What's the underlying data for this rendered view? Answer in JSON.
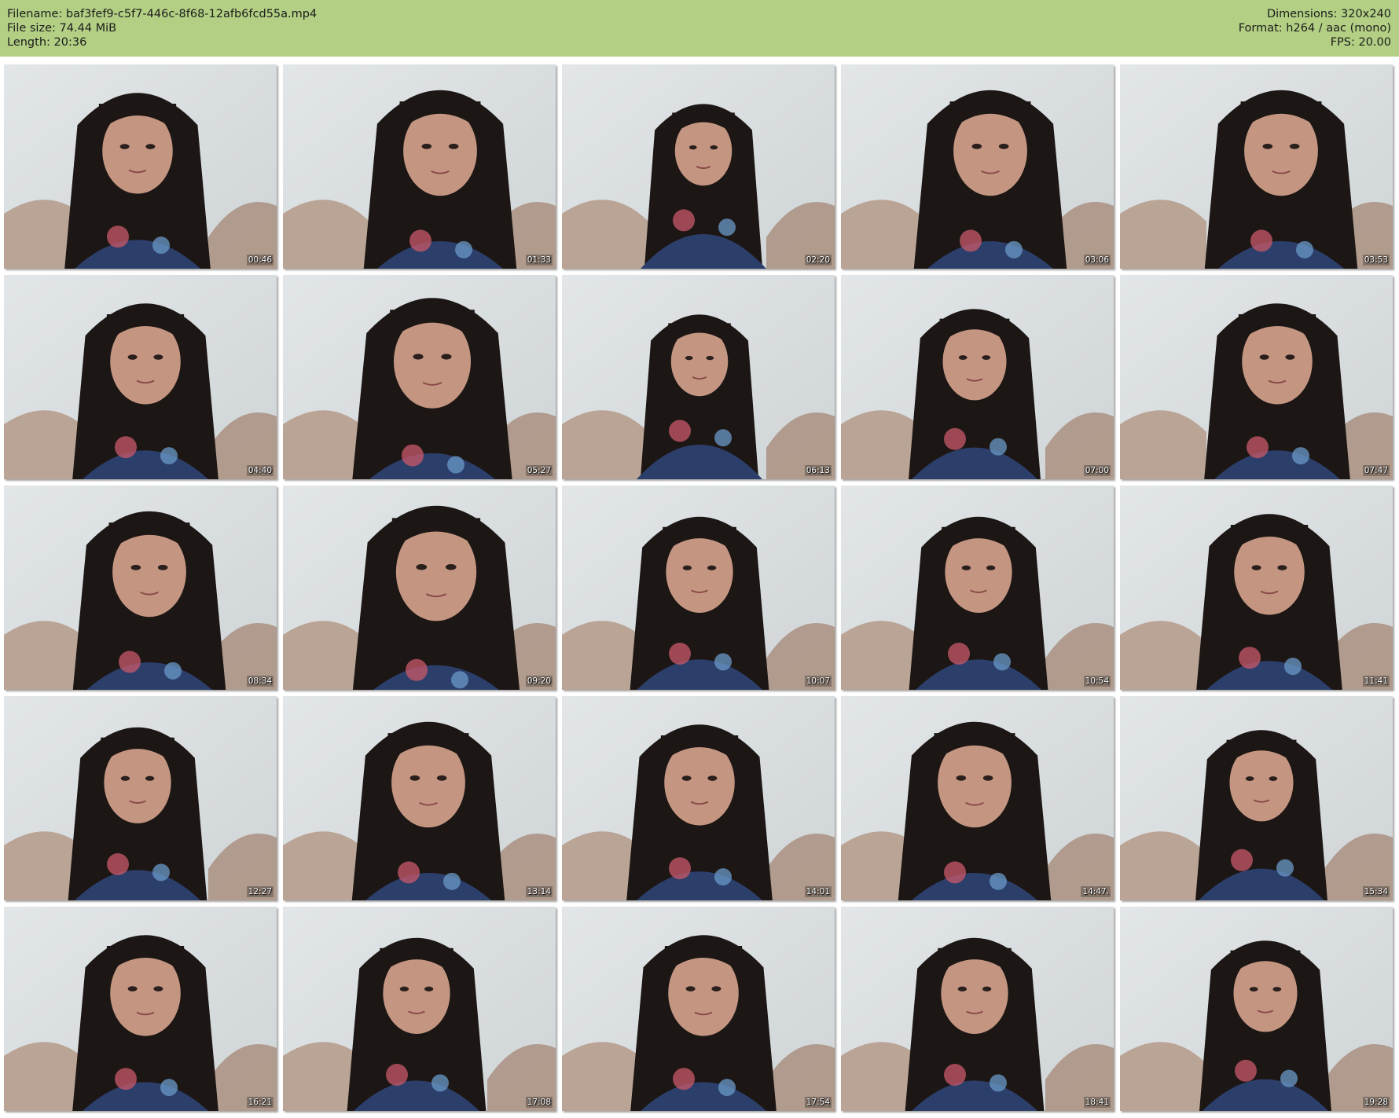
{
  "header": {
    "filename": "Filename: baf3fef9-c5f7-446c-8f68-12afb6fcd55a.mp4",
    "filesize": "File size: 74.44 MiB",
    "length": "Length: 20:36",
    "dimensions": "Dimensions: 320x240",
    "format": "Format: h264 / aac (mono)",
    "fps": "FPS: 20.00"
  },
  "colors": {
    "header_bg": "#b2cf84",
    "wall": "#cfd4d6",
    "hair": "#1c1614",
    "skin": "#c49682",
    "dress": "#2c3e6a"
  },
  "frames": [
    {
      "timestamp": "00:46"
    },
    {
      "timestamp": "01:33"
    },
    {
      "timestamp": "02:20"
    },
    {
      "timestamp": "03:06"
    },
    {
      "timestamp": "03:53"
    },
    {
      "timestamp": "04:40"
    },
    {
      "timestamp": "05:27"
    },
    {
      "timestamp": "06:13"
    },
    {
      "timestamp": "07:00"
    },
    {
      "timestamp": "07:47"
    },
    {
      "timestamp": "08:34"
    },
    {
      "timestamp": "09:20"
    },
    {
      "timestamp": "10:07"
    },
    {
      "timestamp": "10:54"
    },
    {
      "timestamp": "11:41"
    },
    {
      "timestamp": "12:27"
    },
    {
      "timestamp": "13:14"
    },
    {
      "timestamp": "14:01"
    },
    {
      "timestamp": "14:47."
    },
    {
      "timestamp": "15:34"
    },
    {
      "timestamp": "16:21"
    },
    {
      "timestamp": "17:08"
    },
    {
      "timestamp": "17:54"
    },
    {
      "timestamp": "18:41"
    },
    {
      "timestamp": "19:28"
    }
  ]
}
